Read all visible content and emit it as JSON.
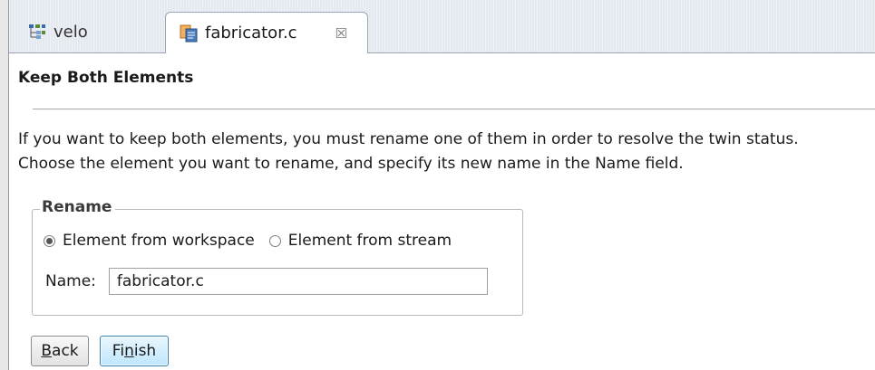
{
  "tabs": [
    {
      "label": "velo",
      "icon": "project-tree-icon",
      "active": false
    },
    {
      "label": "fabricator.c",
      "icon": "file-copy-icon",
      "active": true,
      "close_icon": "close-icon",
      "close_glyph": "☒"
    }
  ],
  "panel": {
    "title": "Keep Both Elements",
    "description_line1": "If you want to keep both elements, you must rename one of them in order to resolve the twin status.",
    "description_line2": "Choose the element you want to rename, and specify its new name in the Name field."
  },
  "rename_group": {
    "title": "Rename",
    "options": [
      {
        "label": "Element from workspace",
        "selected": true
      },
      {
        "label": "Element from stream",
        "selected": false
      }
    ],
    "name_label": "Name:",
    "name_value": "fabricator.c"
  },
  "buttons": {
    "back": {
      "label": "Back",
      "mnemonic": "B",
      "rest": "ack"
    },
    "finish": {
      "label": "Finish",
      "pre": "Fi",
      "mnemonic": "n",
      "rest": "ish"
    }
  },
  "colors": {
    "tabbar": "#e4e8ef",
    "focus_border": "#3c7fb1"
  }
}
